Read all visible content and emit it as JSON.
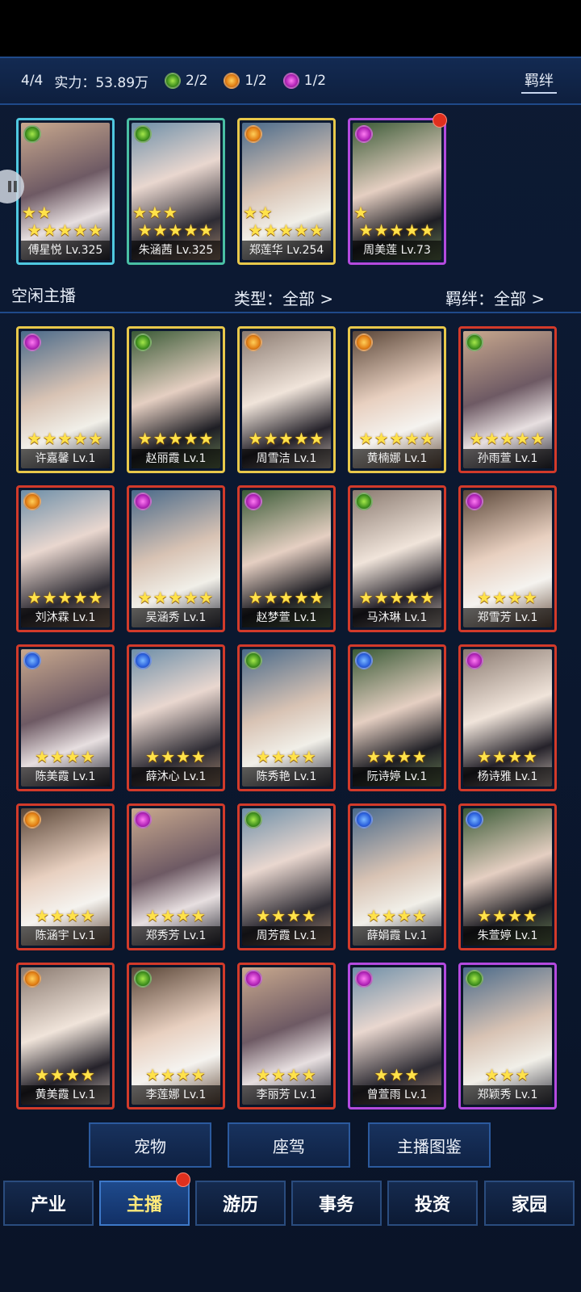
{
  "header": {
    "count": "4/4",
    "power": "实力：53.89万",
    "bonds": [
      {
        "icon": "green-emblem-icon",
        "text": "2/2"
      },
      {
        "icon": "orange-emblem-icon",
        "text": "1/2"
      },
      {
        "icon": "purple-emblem-icon",
        "text": "1/2"
      }
    ],
    "fetter_label": "羁绊"
  },
  "team": [
    {
      "name": "傅星悦 Lv.325",
      "stars": 7,
      "emblem": "green",
      "border": "cyan"
    },
    {
      "name": "朱涵茜 Lv.325",
      "stars": 8,
      "emblem": "green",
      "border": "teal"
    },
    {
      "name": "郑莲华 Lv.254",
      "stars": 7,
      "emblem": "orange",
      "border": "gold"
    },
    {
      "name": "周美莲 Lv.73",
      "stars": 6,
      "emblem": "purple",
      "border": "purple"
    }
  ],
  "filters": {
    "idle_label": "空闲主播",
    "type_label": "类型：全部 >",
    "fetter_label": "羁绊：全部 >"
  },
  "cards": [
    {
      "name": "许嘉馨 Lv.1",
      "stars": 5,
      "emblem": "purple",
      "border": "gold"
    },
    {
      "name": "赵丽霞 Lv.1",
      "stars": 5,
      "emblem": "green",
      "border": "gold"
    },
    {
      "name": "周雪洁 Lv.1",
      "stars": 5,
      "emblem": "orange",
      "border": "gold"
    },
    {
      "name": "黄楠娜 Lv.1",
      "stars": 5,
      "emblem": "orange",
      "border": "gold"
    },
    {
      "name": "孙雨萱 Lv.1",
      "stars": 5,
      "emblem": "green",
      "border": "red"
    },
    {
      "name": "刘沐霖 Lv.1",
      "stars": 5,
      "emblem": "orange",
      "border": "red"
    },
    {
      "name": "吴涵秀 Lv.1",
      "stars": 5,
      "emblem": "purple",
      "border": "red"
    },
    {
      "name": "赵梦萱 Lv.1",
      "stars": 5,
      "emblem": "purple",
      "border": "red"
    },
    {
      "name": "马沐琳 Lv.1",
      "stars": 5,
      "emblem": "green",
      "border": "red"
    },
    {
      "name": "郑雪芳 Lv.1",
      "stars": 4,
      "emblem": "purple",
      "border": "red"
    },
    {
      "name": "陈美霞 Lv.1",
      "stars": 4,
      "emblem": "blue",
      "border": "red"
    },
    {
      "name": "薛沐心 Lv.1",
      "stars": 4,
      "emblem": "blue",
      "border": "red"
    },
    {
      "name": "陈秀艳 Lv.1",
      "stars": 4,
      "emblem": "green",
      "border": "red"
    },
    {
      "name": "阮诗婷 Lv.1",
      "stars": 4,
      "emblem": "blue",
      "border": "red"
    },
    {
      "name": "杨诗雅 Lv.1",
      "stars": 4,
      "emblem": "purple",
      "border": "red"
    },
    {
      "name": "陈涵宇 Lv.1",
      "stars": 4,
      "emblem": "orange",
      "border": "red"
    },
    {
      "name": "郑秀芳 Lv.1",
      "stars": 4,
      "emblem": "purple",
      "border": "red"
    },
    {
      "name": "周芳霞 Lv.1",
      "stars": 4,
      "emblem": "green",
      "border": "red"
    },
    {
      "name": "薛娟霞 Lv.1",
      "stars": 4,
      "emblem": "blue",
      "border": "red"
    },
    {
      "name": "朱萱婷 Lv.1",
      "stars": 4,
      "emblem": "blue",
      "border": "red"
    },
    {
      "name": "黄美霞 Lv.1",
      "stars": 4,
      "emblem": "orange",
      "border": "red"
    },
    {
      "name": "李莲娜 Lv.1",
      "stars": 4,
      "emblem": "green",
      "border": "red"
    },
    {
      "name": "李丽芳 Lv.1",
      "stars": 4,
      "emblem": "purple",
      "border": "red"
    },
    {
      "name": "曾萱雨 Lv.1",
      "stars": 3,
      "emblem": "purple",
      "border": "purple"
    },
    {
      "name": "郑颖秀 Lv.1",
      "stars": 3,
      "emblem": "green",
      "border": "purple"
    }
  ],
  "actions": {
    "pet": "宠物",
    "mount": "座驾",
    "catalog": "主播图鉴"
  },
  "tabs": [
    "产业",
    "主播",
    "游历",
    "事务",
    "投资",
    "家园"
  ],
  "active_tab": "主播",
  "colors": {
    "star": "#ffe24a",
    "notification": "#e0301e",
    "active_tab_text": "#ffe97a"
  }
}
